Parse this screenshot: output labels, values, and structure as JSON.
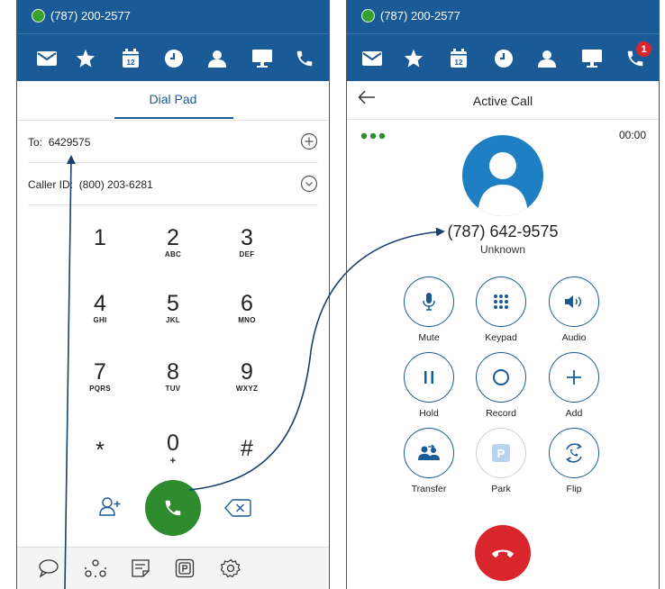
{
  "left": {
    "status_phone": "(787) 200-2577",
    "tab_label": "Dial Pad",
    "to_label": "To:",
    "to_value": "6429575",
    "callerid_label": "Caller ID:",
    "callerid_value": "(800) 203-6281",
    "keys": [
      {
        "num": "1",
        "sub": ""
      },
      {
        "num": "2",
        "sub": "ABC"
      },
      {
        "num": "3",
        "sub": "DEF"
      },
      {
        "num": "4",
        "sub": "GHI"
      },
      {
        "num": "5",
        "sub": "JKL"
      },
      {
        "num": "6",
        "sub": "MNO"
      },
      {
        "num": "7",
        "sub": "PQRS"
      },
      {
        "num": "8",
        "sub": "TUV"
      },
      {
        "num": "9",
        "sub": "WXYZ"
      },
      {
        "num": "*",
        "sub": ""
      },
      {
        "num": "0",
        "sub": "+"
      },
      {
        "num": "#",
        "sub": ""
      }
    ]
  },
  "right": {
    "status_phone": "(787) 200-2577",
    "title": "Active Call",
    "timer": "00:00",
    "caller_number": "(787) 642-9575",
    "caller_name": "Unknown",
    "phone_badge": "1",
    "buttons": {
      "mute": "Mute",
      "keypad": "Keypad",
      "audio": "Audio",
      "hold": "Hold",
      "record": "Record",
      "add": "Add",
      "transfer": "Transfer",
      "park": "Park",
      "flip": "Flip"
    },
    "park_letter": "P"
  },
  "colors": {
    "header": "#1a5a97",
    "status_dot": "#36a12c",
    "call_green": "#2e8b2e",
    "end_red": "#d9262c",
    "avatar_blue": "#1e80c3",
    "arrow": "#1a3f6b"
  },
  "icons": {
    "nav": [
      "envelope-icon",
      "star-icon",
      "calendar-icon",
      "clock-icon",
      "contacts-icon",
      "monitor-icon",
      "phone-icon"
    ],
    "bottom": [
      "chat-icon",
      "network-icon",
      "notes-icon",
      "parking-icon",
      "settings-icon"
    ]
  }
}
